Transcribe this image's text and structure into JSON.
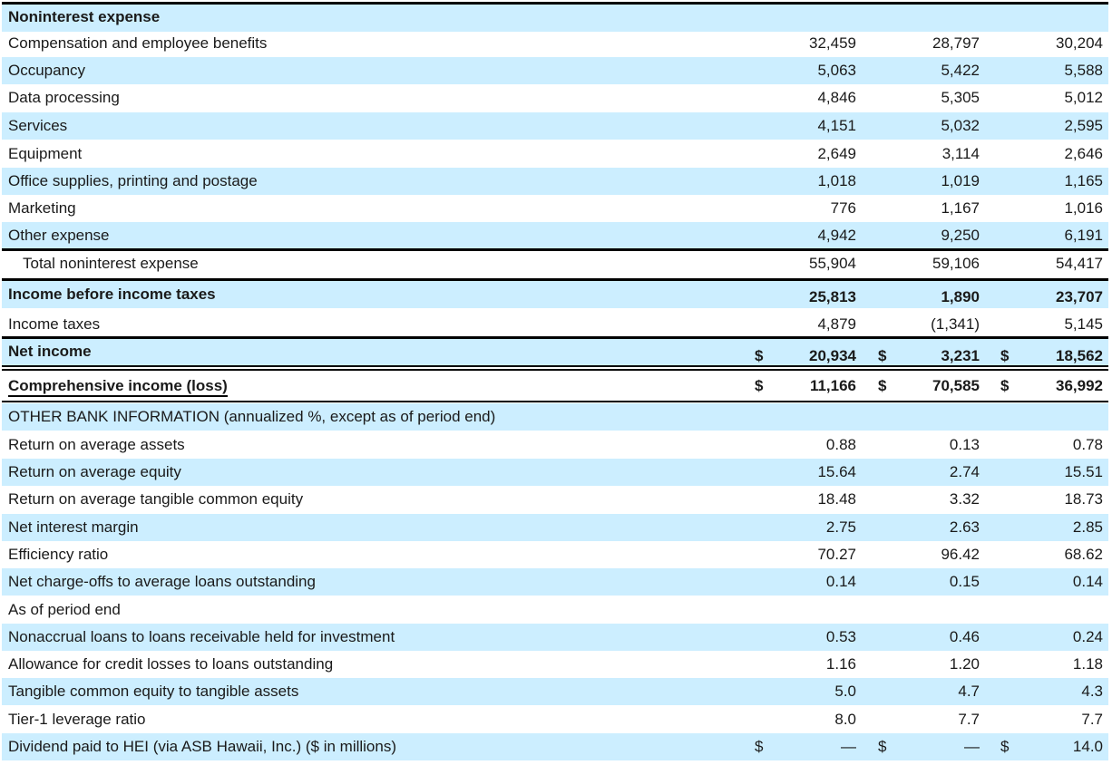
{
  "rows": [
    {
      "label": "Noninterest expense",
      "bold": true,
      "blue": true,
      "values": [
        "",
        "",
        ""
      ]
    },
    {
      "label": "Compensation and employee benefits",
      "values": [
        "32,459",
        "28,797",
        "30,204"
      ]
    },
    {
      "label": "Occupancy",
      "blue": true,
      "values": [
        "5,063",
        "5,422",
        "5,588"
      ]
    },
    {
      "label": "Data processing",
      "values": [
        "4,846",
        "5,305",
        "5,012"
      ]
    },
    {
      "label": "Services",
      "blue": true,
      "values": [
        "4,151",
        "5,032",
        "2,595"
      ]
    },
    {
      "label": "Equipment",
      "values": [
        "2,649",
        "3,114",
        "2,646"
      ]
    },
    {
      "label": "Office supplies, printing and postage",
      "blue": true,
      "values": [
        "1,018",
        "1,019",
        "1,165"
      ]
    },
    {
      "label": "Marketing",
      "values": [
        "776",
        "1,167",
        "1,016"
      ]
    },
    {
      "label": "Other expense",
      "blue": true,
      "values": [
        "4,942",
        "9,250",
        "6,191"
      ]
    },
    {
      "label": "Total noninterest expense",
      "indent": true,
      "values": [
        "55,904",
        "59,106",
        "54,417"
      ]
    },
    {
      "label": "Income before income taxes",
      "bold": true,
      "blue": true,
      "values": [
        "25,813",
        "1,890",
        "23,707"
      ]
    },
    {
      "label": "Income taxes",
      "values": [
        "4,879",
        "(1,341)",
        "5,145"
      ]
    },
    {
      "label": "Net income",
      "bold": true,
      "blue": true,
      "dollar": "$",
      "values": [
        "20,934",
        "3,231",
        "18,562"
      ]
    },
    {
      "label": "Comprehensive income (loss)",
      "bold": true,
      "underline": true,
      "dollar": "$",
      "values": [
        "11,166",
        "70,585",
        "36,992"
      ]
    },
    {
      "label": "OTHER BANK INFORMATION (annualized %, except as of period end)",
      "blue": true,
      "values": [
        "",
        "",
        ""
      ]
    },
    {
      "label": "Return on average assets",
      "values": [
        "0.88",
        "0.13",
        "0.78"
      ]
    },
    {
      "label": "Return on average equity",
      "blue": true,
      "values": [
        "15.64",
        "2.74",
        "15.51"
      ]
    },
    {
      "label": "Return on average tangible common equity",
      "values": [
        "18.48",
        "3.32",
        "18.73"
      ]
    },
    {
      "label": "Net interest margin",
      "blue": true,
      "values": [
        "2.75",
        "2.63",
        "2.85"
      ]
    },
    {
      "label": "Efficiency ratio",
      "values": [
        "70.27",
        "96.42",
        "68.62"
      ]
    },
    {
      "label": "Net charge-offs to average loans outstanding",
      "blue": true,
      "values": [
        "0.14",
        "0.15",
        "0.14"
      ]
    },
    {
      "label": "As of period end",
      "values": [
        "",
        "",
        ""
      ]
    },
    {
      "label": "Nonaccrual loans to loans receivable held for investment",
      "blue": true,
      "values": [
        "0.53",
        "0.46",
        "0.24"
      ]
    },
    {
      "label": "Allowance for credit losses to loans outstanding",
      "values": [
        "1.16",
        "1.20",
        "1.18"
      ]
    },
    {
      "label": "Tangible common equity to tangible assets",
      "blue": true,
      "values": [
        "5.0",
        "4.7",
        "4.3"
      ]
    },
    {
      "label": "Tier-1 leverage ratio",
      "values": [
        "8.0",
        "7.7",
        "7.7"
      ]
    },
    {
      "label": "Dividend paid to HEI (via ASB Hawaii, Inc.) ($ in millions)",
      "blue": true,
      "dollar": "$",
      "values": [
        "—",
        "—",
        "14.0"
      ]
    }
  ]
}
